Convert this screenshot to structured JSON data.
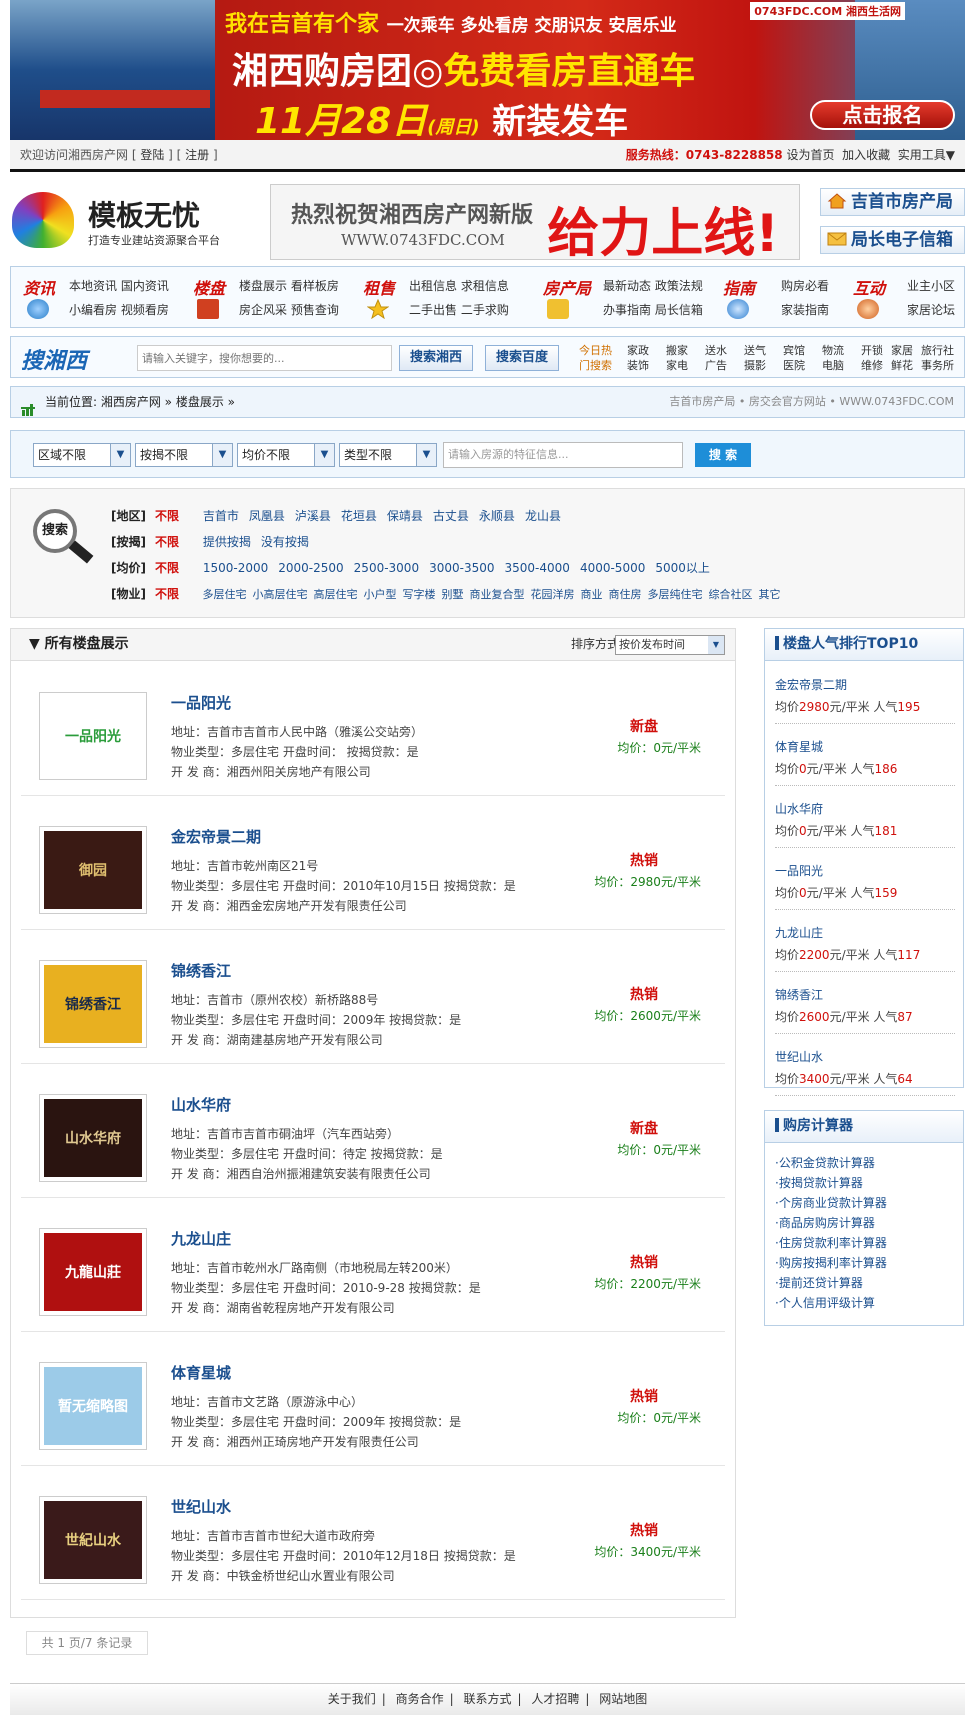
{
  "banner": {
    "line1": "我在吉首有个家",
    "line1b": "一次乘车 多处看房 交朋识友 安居乐业",
    "line2a": "湘西购房团◎",
    "line2b": "免费看房直通车",
    "line3a": "11月28日",
    "line3b": "(周日)",
    "line3c": "新装发车",
    "logo": "0743FDC.COM 湘西生活网",
    "cta": "点击报名"
  },
  "topbar": {
    "welcome": "欢迎访问湘西房产网",
    "login": "登陆",
    "register": "注册",
    "hotline_label": "服务热线：0743-8228858",
    "links": [
      "设为首页",
      "加入收藏",
      "实用工具▼"
    ]
  },
  "logo": {
    "title": "模板无忧",
    "subtitle": "打造专业建站资源聚合平台"
  },
  "mid_ad": {
    "t1": "热烈祝贺湘西房产网新版",
    "t2": "WWW.0743FDC.COM",
    "t3": "给力上线!"
  },
  "header_buttons": {
    "b1": "吉首市房产局",
    "b2": "局长电子信箱"
  },
  "nav": [
    {
      "title": "资讯",
      "l1": "本地资讯  国内资讯",
      "l2": "小编看房  视频看房",
      "color": "#2a7fc9"
    },
    {
      "title": "楼盘",
      "l1": "楼盘展示  看样板房",
      "l2": "房企风采  预售查询",
      "color": "#d04020"
    },
    {
      "title": "租售",
      "l1": "出租信息  求租信息",
      "l2": "二手出售  二手求购",
      "color": "#f0b020"
    },
    {
      "title": "房产局",
      "l1": "最新动态  政策法规",
      "l2": "办事指南  局长信箱",
      "color": "#30a030"
    },
    {
      "title": "指南",
      "l1": "购房必看",
      "l2": "家装指南",
      "color": "#3080d0"
    },
    {
      "title": "互动",
      "l1": "业主小区",
      "l2": "家居论坛",
      "color": "#d06020"
    }
  ],
  "searchbar": {
    "logo": "搜湘西",
    "placeholder": "请输入关键字，搜你想要的...",
    "btn1": "搜索湘西",
    "btn2": "搜索百度",
    "hot": "今日热\n门搜索",
    "hotlinks": [
      [
        "家政",
        "装饰"
      ],
      [
        "搬家",
        "家电"
      ],
      [
        "送水",
        "广告"
      ],
      [
        "送气",
        "摄影"
      ],
      [
        "宾馆",
        "医院"
      ],
      [
        "物流",
        "电脑"
      ],
      [
        "开锁",
        "维修"
      ],
      [
        "家居",
        "鲜花"
      ],
      [
        "旅行社",
        "事务所"
      ]
    ]
  },
  "crumb": {
    "text": "当前位置: 湘西房产网 » 楼盘展示 »",
    "right": "吉首市房产局 • 房交会官方网站 • WWW.0743FDC.COM"
  },
  "filter": {
    "selects": [
      "区域不限",
      "按揭不限",
      "均价不限",
      "类型不限"
    ],
    "placeholder": "请输入房源的特征信息...",
    "go": "搜 索"
  },
  "conditions": {
    "icon_text": "搜索",
    "rows": [
      {
        "key": "[地区]",
        "none": "不限",
        "opts": [
          "吉首市",
          "凤凰县",
          "泸溪县",
          "花垣县",
          "保靖县",
          "古丈县",
          "永顺县",
          "龙山县"
        ]
      },
      {
        "key": "[按揭]",
        "none": "不限",
        "opts": [
          "提供按揭",
          "没有按揭"
        ]
      },
      {
        "key": "[均价]",
        "none": "不限",
        "opts": [
          "1500-2000",
          "2000-2500",
          "2500-3000",
          "3000-3500",
          "3500-4000",
          "4000-5000",
          "5000以上"
        ]
      },
      {
        "key": "[物业]",
        "none": "不限",
        "opts": [
          "多层住宅",
          "小高层住宅",
          "高层住宅",
          "小户型",
          "写字楼",
          "别墅",
          "商业复合型",
          "花园洋房",
          "商业",
          "商住房",
          "多层纯住宅",
          "综合社区",
          "其它"
        ]
      }
    ]
  },
  "main": {
    "title": "▼ 所有楼盘展示",
    "sort_label": "排序方式：",
    "sort_value": "按价发布时间"
  },
  "listings": [
    {
      "name": "一品阳光",
      "addr": "地址：吉首市吉首市人民中路（雅溪公交站旁）",
      "type": "物业类型：多层住宅  开盘时间：  按揭贷款：是",
      "dev": "开 发 商：湘西州阳关房地产有限公司",
      "status": "新盘",
      "price": "均价：0元/平米",
      "img_bg": "#ffffff",
      "img_fg": "#2a9c3a",
      "img_text": "一品阳光"
    },
    {
      "name": "金宏帝景二期",
      "addr": "地址：吉首市乾州南区21号",
      "type": "物业类型：多层住宅  开盘时间：2010年10月15日  按揭贷款：是",
      "dev": "开 发 商：湘西金宏房地产开发有限责任公司",
      "status": "热销",
      "price": "均价：2980元/平米",
      "img_bg": "#3a1a14",
      "img_fg": "#e0c070",
      "img_text": "御园"
    },
    {
      "name": "锦绣香江",
      "addr": "地址：吉首市（原州农校）新桥路88号",
      "type": "物业类型：多层住宅  开盘时间：2009年  按揭贷款：是",
      "dev": "开 发 商：湖南建基房地产开发有限公司",
      "status": "热销",
      "price": "均价：2600元/平米",
      "img_bg": "#e8b020",
      "img_fg": "#1a2a4a",
      "img_text": "锦绣香江"
    },
    {
      "name": "山水华府",
      "addr": "地址：吉首市吉首市硐油坪（汽车西站旁）",
      "type": "物业类型：多层住宅  开盘时间：待定  按揭贷款：是",
      "dev": "开 发 商：湘西自治州振湘建筑安装有限责任公司",
      "status": "新盘",
      "price": "均价：0元/平米",
      "img_bg": "#2a1410",
      "img_fg": "#e0c890",
      "img_text": "山水华府"
    },
    {
      "name": "九龙山庄",
      "addr": "地址：吉首市乾州水厂路南侧（市地税局左转200米）",
      "type": "物业类型：多层住宅  开盘时间：2010-9-28  按揭贷款：是",
      "dev": "开 发 商：湖南省乾程房地产开发有限公司",
      "status": "热销",
      "price": "均价：2200元/平米",
      "img_bg": "#b01010",
      "img_fg": "#ffffff",
      "img_text": "九龍山莊"
    },
    {
      "name": "体育星城",
      "addr": "地址：吉首市文艺路（原游泳中心）",
      "type": "物业类型：多层住宅  开盘时间：2009年  按揭贷款：是",
      "dev": "开 发 商：湘西州正琦房地产开发有限责任公司",
      "status": "热销",
      "price": "均价：0元/平米",
      "img_bg": "#9ccbe8",
      "img_fg": "#ffffff",
      "img_text": "暂无缩略图"
    },
    {
      "name": "世纪山水",
      "addr": "地址：吉首市吉首市世纪大道市政府旁",
      "type": "物业类型：多层住宅  开盘时间：2010年12月18日  按揭贷款：是",
      "dev": "开 发 商：中铁金桥世纪山水置业有限公司",
      "status": "热销",
      "price": "均价：3400元/平米",
      "img_bg": "#3a1a1a",
      "img_fg": "#e8d080",
      "img_text": "世紀山水"
    }
  ],
  "pager": "共 1 页/7 条记录",
  "ranking": {
    "title": "楼盘人气排行TOP10",
    "items": [
      {
        "name": "金宏帝景二期",
        "pl": "均价",
        "price": "2980",
        "pu": "元/平米  人气",
        "pop": "195"
      },
      {
        "name": "体育星城",
        "pl": "均价",
        "price": "0",
        "pu": "元/平米  人气",
        "pop": "186"
      },
      {
        "name": "山水华府",
        "pl": "均价",
        "price": "0",
        "pu": "元/平米  人气",
        "pop": "181"
      },
      {
        "name": "一品阳光",
        "pl": "均价",
        "price": "0",
        "pu": "元/平米  人气",
        "pop": "159"
      },
      {
        "name": "九龙山庄",
        "pl": "均价",
        "price": "2200",
        "pu": "元/平米  人气",
        "pop": "117"
      },
      {
        "name": "锦绣香江",
        "pl": "均价",
        "price": "2600",
        "pu": "元/平米  人气",
        "pop": "87"
      },
      {
        "name": "世纪山水",
        "pl": "均价",
        "price": "3400",
        "pu": "元/平米  人气",
        "pop": "64"
      }
    ]
  },
  "calc": {
    "title": "购房计算器",
    "links": [
      "·公积金贷款计算器",
      "·按揭贷款计算器",
      "·个房商业贷款计算器",
      "·商品房购房计算器",
      "·住房贷款利率计算器",
      "·购房按揭利率计算器",
      "·提前还贷计算器",
      "·个人信用评级计算"
    ]
  },
  "footer": [
    "关于我们",
    "商务合作",
    "联系方式",
    "人才招聘",
    "网站地图"
  ]
}
